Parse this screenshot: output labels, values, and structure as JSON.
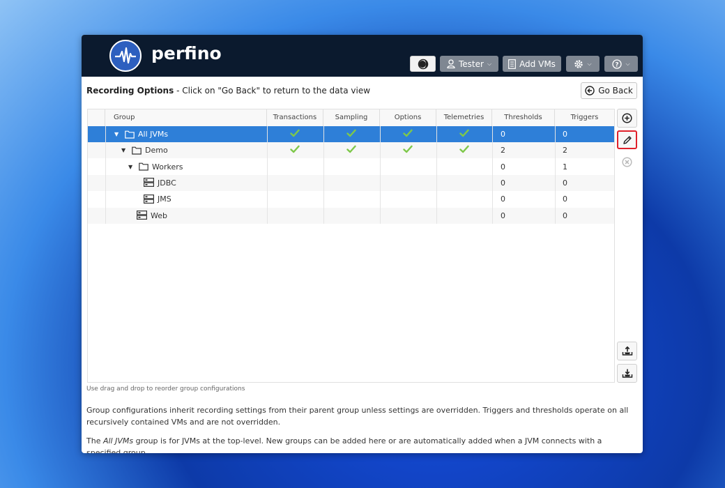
{
  "app": {
    "name": "perfino"
  },
  "header": {
    "theme_button": "theme-toggle",
    "user_label": "Tester",
    "add_vms_label": "Add VMs"
  },
  "page": {
    "title_bold": "Recording Options",
    "title_rest": " - Click on \"Go Back\" to return to the data view",
    "go_back_label": "Go Back"
  },
  "table": {
    "columns": [
      "Group",
      "Transactions",
      "Sampling",
      "Options",
      "Telemetries",
      "Thresholds",
      "Triggers"
    ],
    "rows": [
      {
        "name": "All JVMs",
        "type": "folder",
        "expanded": true,
        "transactions": true,
        "sampling": true,
        "options": true,
        "telemetries": true,
        "thresholds": "0",
        "triggers": "0",
        "selected": true
      },
      {
        "name": "Demo",
        "type": "folder",
        "expanded": true,
        "transactions": true,
        "sampling": true,
        "options": true,
        "telemetries": true,
        "thresholds": "2",
        "triggers": "2"
      },
      {
        "name": "Workers",
        "type": "folder",
        "expanded": true,
        "transactions": false,
        "sampling": false,
        "options": false,
        "telemetries": false,
        "thresholds": "0",
        "triggers": "1"
      },
      {
        "name": "JDBC",
        "type": "server",
        "thresholds": "0",
        "triggers": "0"
      },
      {
        "name": "JMS",
        "type": "server",
        "thresholds": "0",
        "triggers": "0"
      },
      {
        "name": "Web",
        "type": "server",
        "thresholds": "0",
        "triggers": "0"
      }
    ]
  },
  "side_buttons": [
    "add-icon",
    "edit-icon",
    "remove-icon",
    "export-icon",
    "import-icon"
  ],
  "hint": "Use drag and drop to reorder group configurations",
  "info": {
    "p1": "Group configurations inherit recording settings from their parent group unless settings are overridden. Triggers and thresholds operate on all recursively contained VMs and are not overridden.",
    "p2_pre": "The ",
    "p2_em": "All JVMs",
    "p2_post": " group is for JVMs at the top-level. New groups can be added here or are automatically added when a JVM connects with a specified group."
  },
  "colors": {
    "header_bg": "#0b1a2e",
    "selection": "#2e7fd8",
    "check": "#7ec84a",
    "highlight": "#e0202a"
  }
}
